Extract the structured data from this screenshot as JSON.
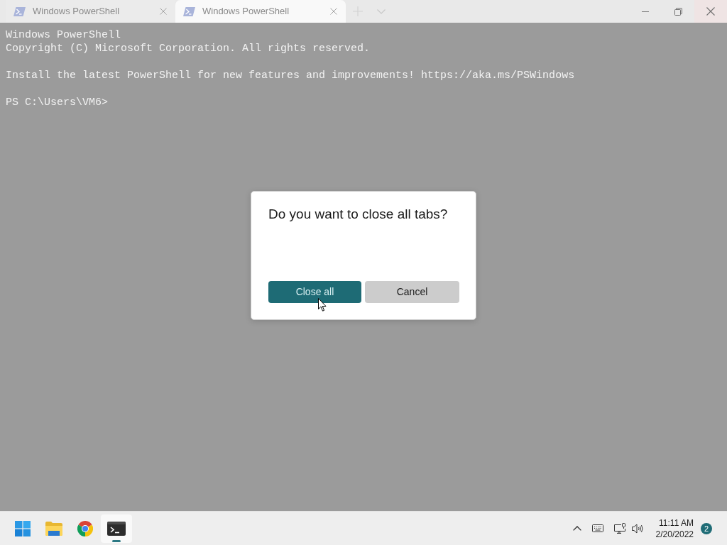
{
  "tabs": [
    {
      "title": "Windows PowerShell",
      "selected": false
    },
    {
      "title": "Windows PowerShell",
      "selected": true
    }
  ],
  "terminal": {
    "blocks": [
      [
        "Windows PowerShell",
        "Copyright (C) Microsoft Corporation. All rights reserved."
      ],
      [
        "Install the latest PowerShell for new features and improvements! https://aka.ms/PSWindows"
      ],
      [
        "PS C:\\Users\\VM6>"
      ]
    ]
  },
  "dialog": {
    "message": "Do you want to close all tabs?",
    "buttons": [
      {
        "label": "Close all",
        "kind": "primary"
      },
      {
        "label": "Cancel",
        "kind": "secondary"
      }
    ]
  },
  "taskbar": {
    "apps": [
      {
        "kind": "start",
        "active": false
      },
      {
        "kind": "explorer",
        "active": false
      },
      {
        "kind": "browser",
        "active": false
      },
      {
        "kind": "terminal",
        "active": true
      }
    ],
    "clock": {
      "time": "11:11 AM",
      "date": "2/20/2022"
    },
    "notifications": "2"
  }
}
